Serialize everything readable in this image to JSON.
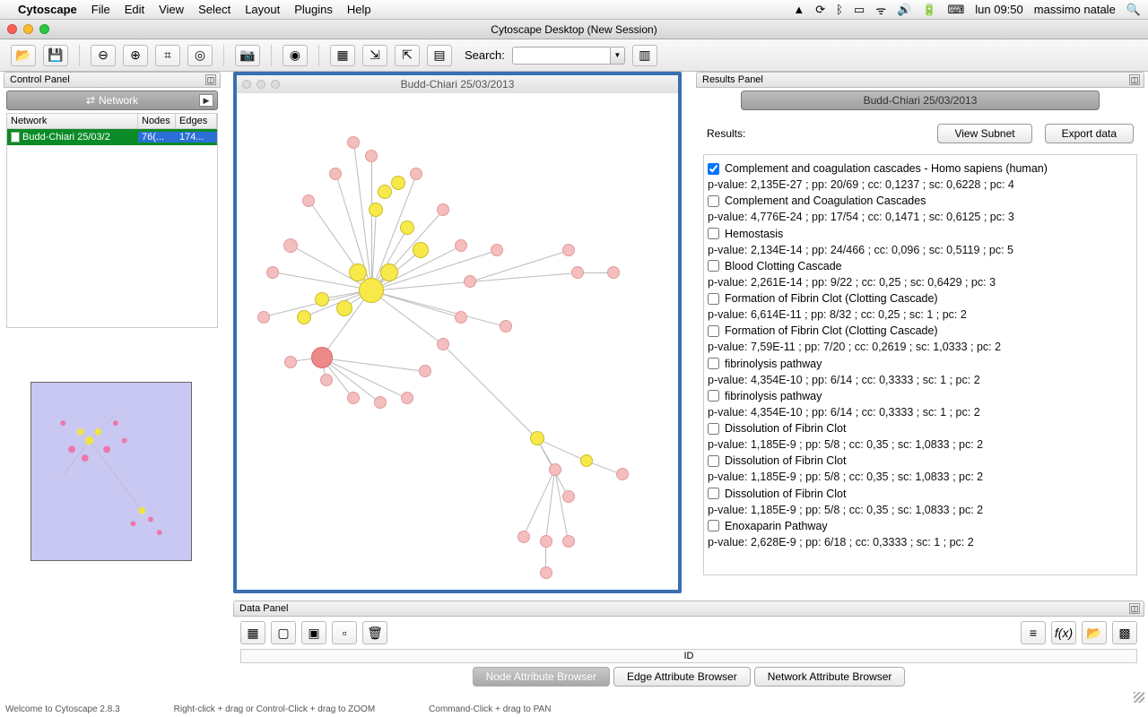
{
  "menubar": {
    "app": "Cytoscape",
    "items": [
      "File",
      "Edit",
      "View",
      "Select",
      "Layout",
      "Plugins",
      "Help"
    ],
    "clock": "lun 09:50",
    "user": "massimo natale"
  },
  "window_title": "Cytoscape Desktop (New Session)",
  "toolbar": {
    "search_label": "Search:"
  },
  "control_panel": {
    "title": "Control Panel",
    "tab": "Network",
    "cols": {
      "network": "Network",
      "nodes": "Nodes",
      "edges": "Edges"
    },
    "row": {
      "name": "Budd-Chiari 25/03/2",
      "nodes": "76(...",
      "edges": "174..."
    }
  },
  "canvas": {
    "title": "Budd-Chiari 25/03/2013"
  },
  "results": {
    "title": "Results Panel",
    "tab": "Budd-Chiari 25/03/2013",
    "label": "Results:",
    "view_btn": "View Subnet",
    "export_btn": "Export data",
    "items": [
      {
        "checked": true,
        "name": "Complement and coagulation cascades - Homo sapiens (human)",
        "stat": "p-value: 2,135E-27 ; pp: 20/69 ; cc: 0,1237 ; sc: 0,6228 ; pc: 4"
      },
      {
        "checked": false,
        "name": "Complement and Coagulation Cascades",
        "stat": "p-value: 4,776E-24 ; pp: 17/54 ; cc: 0,1471 ; sc: 0,6125 ; pc: 3"
      },
      {
        "checked": false,
        "name": "Hemostasis",
        "stat": "p-value: 2,134E-14 ; pp: 24/466 ; cc: 0,096 ; sc: 0,5119 ; pc: 5"
      },
      {
        "checked": false,
        "name": "Blood Clotting Cascade",
        "stat": "p-value: 2,261E-14 ; pp: 9/22 ; cc: 0,25 ; sc: 0,6429 ; pc: 3"
      },
      {
        "checked": false,
        "name": "Formation of Fibrin Clot (Clotting Cascade)",
        "stat": "p-value: 6,614E-11 ; pp: 8/32 ; cc: 0,25 ; sc: 1 ; pc: 2"
      },
      {
        "checked": false,
        "name": "Formation of Fibrin Clot (Clotting Cascade)",
        "stat": "p-value: 7,59E-11 ; pp: 7/20 ; cc: 0,2619 ; sc: 1,0333 ; pc: 2"
      },
      {
        "checked": false,
        "name": "fibrinolysis pathway",
        "stat": "p-value: 4,354E-10 ; pp: 6/14 ; cc: 0,3333 ; sc: 1 ; pc: 2"
      },
      {
        "checked": false,
        "name": "fibrinolysis pathway",
        "stat": "p-value: 4,354E-10 ; pp: 6/14 ; cc: 0,3333 ; sc: 1 ; pc: 2"
      },
      {
        "checked": false,
        "name": "Dissolution of Fibrin Clot",
        "stat": "p-value: 1,185E-9 ; pp: 5/8 ; cc: 0,35 ; sc: 1,0833 ; pc: 2"
      },
      {
        "checked": false,
        "name": "Dissolution of Fibrin Clot",
        "stat": "p-value: 1,185E-9 ; pp: 5/8 ; cc: 0,35 ; sc: 1,0833 ; pc: 2"
      },
      {
        "checked": false,
        "name": "Dissolution of Fibrin Clot",
        "stat": "p-value: 1,185E-9 ; pp: 5/8 ; cc: 0,35 ; sc: 1,0833 ; pc: 2"
      },
      {
        "checked": false,
        "name": "Enoxaparin Pathway",
        "stat": "p-value: 2,628E-9 ; pp: 6/18 ; cc: 0,3333 ; sc: 1 ; pc: 2"
      }
    ]
  },
  "data_panel": {
    "title": "Data Panel",
    "id_col": "ID",
    "tabs": {
      "node": "Node Attribute Browser",
      "edge": "Edge Attribute Browser",
      "net": "Network Attribute Browser"
    }
  },
  "status": {
    "welcome": "Welcome to Cytoscape 2.8.3",
    "hint1": "Right-click + drag or Control-Click + drag to ZOOM",
    "hint2": "Command-Click + drag to PAN"
  }
}
